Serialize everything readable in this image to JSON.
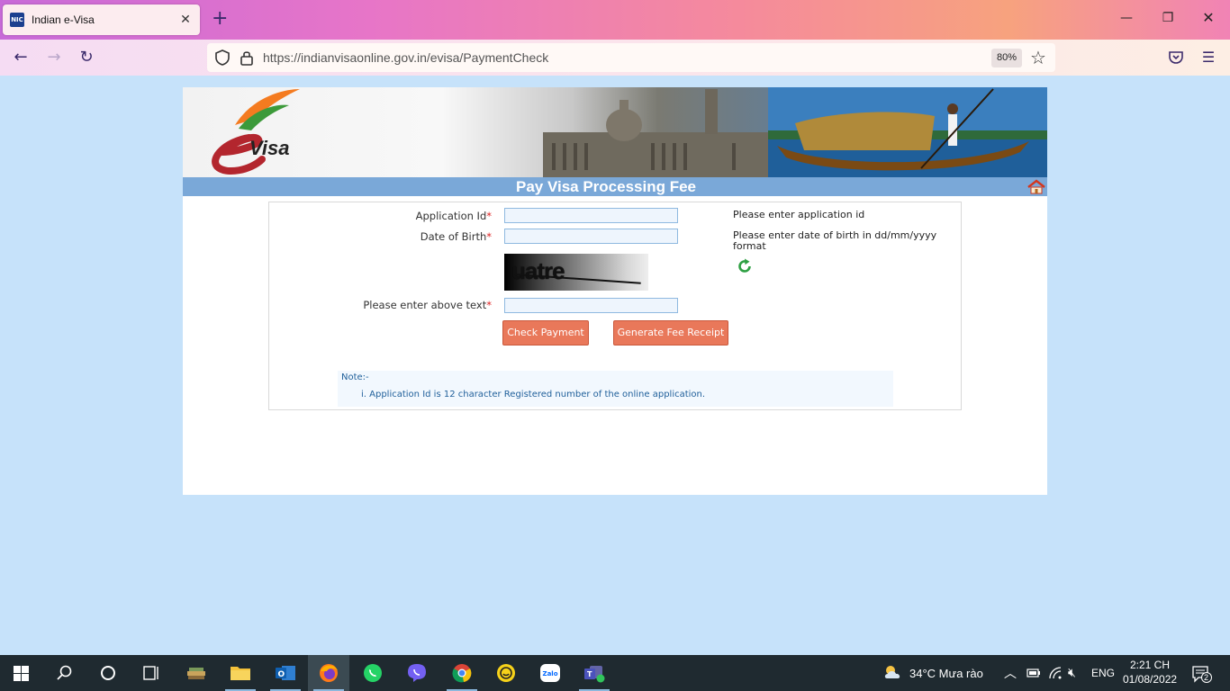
{
  "browser": {
    "tab_title": "Indian e-Visa",
    "tab_favicon_text": "NIC",
    "url": "https://indianvisaonline.gov.in/evisa/PaymentCheck",
    "zoom": "80%"
  },
  "page": {
    "logo_text": "Visa",
    "title": "Pay Visa Processing Fee",
    "form": {
      "application_id_label": "Application Id",
      "dob_label": "Date of Birth",
      "captcha_label": "Please enter above text",
      "required_mark": "*",
      "application_id_hint": "Please enter application id",
      "dob_hint": "Please enter date of birth in dd/mm/yyyy format",
      "captcha_text": "uatre",
      "application_id_value": "",
      "dob_value": "",
      "captcha_value": ""
    },
    "buttons": {
      "check_payment": "Check Payment",
      "generate_receipt": "Generate Fee Receipt"
    },
    "note": {
      "title": "Note:-",
      "items": [
        "i. Application Id is 12 character Registered number of the online application."
      ]
    }
  },
  "taskbar": {
    "weather": "34°C  Mưa rào",
    "language": "ENG",
    "time": "2:21 CH",
    "date": "01/08/2022",
    "notification_count": "2",
    "zalo_label": "Zalo"
  },
  "colors": {
    "page_bg": "#c6e2fa",
    "title_bar": "#7aa8d8",
    "button": "#e9785a"
  }
}
